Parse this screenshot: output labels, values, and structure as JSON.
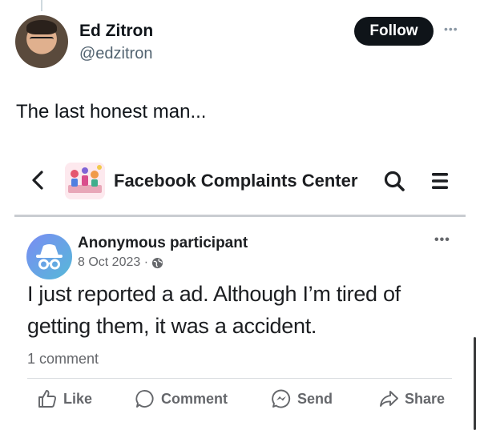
{
  "tweet": {
    "author_name": "Ed Zitron",
    "author_handle": "@edzitron",
    "follow_label": "Follow",
    "more_icon": "more-horizontal-icon",
    "text": "The last honest man..."
  },
  "embed": {
    "back_icon": "chevron-left-icon",
    "group_name": "Facebook Complaints Center",
    "search_icon": "search-icon",
    "menu_icon": "hamburger-menu-icon",
    "post": {
      "author": "Anonymous participant",
      "date": "8 Oct 2023 ·",
      "privacy_icon": "globe-icon",
      "body": "I just reported a ad. Although I’m tired of getting them, it was a accident.",
      "comment_count": "1 comment"
    },
    "actions": [
      {
        "label": "Like",
        "icon": "thumbs-up-icon"
      },
      {
        "label": "Comment",
        "icon": "comment-bubble-icon"
      },
      {
        "label": "Send",
        "icon": "messenger-icon"
      },
      {
        "label": "Share",
        "icon": "share-arrow-icon"
      }
    ]
  },
  "colors": {
    "tweet_text": "#0f1419",
    "handle_gray": "#536471",
    "follow_bg": "#0f1419",
    "fb_text": "#1c1e21",
    "fb_gray": "#65676b",
    "anon_gradient_start": "#7a8cf3",
    "anon_gradient_end": "#56b9d8"
  }
}
